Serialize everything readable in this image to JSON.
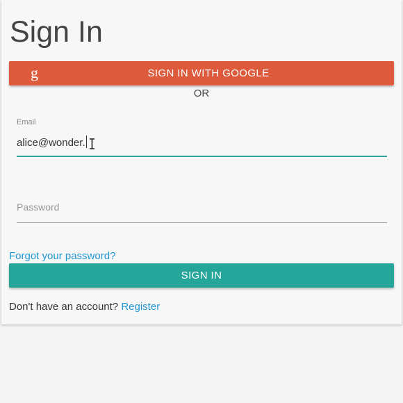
{
  "page": {
    "title": "Sign In"
  },
  "google_button": {
    "label": "SIGN IN WITH GOOGLE",
    "icon": "g",
    "color": "#dd5a3c"
  },
  "divider": {
    "text": "OR"
  },
  "email": {
    "label": "Email",
    "value": "alice@wonder."
  },
  "password": {
    "placeholder": "Password"
  },
  "forgot_link": {
    "text": "Forgot your password?"
  },
  "signin_button": {
    "label": "SIGN IN",
    "color": "#26a69a"
  },
  "register": {
    "prompt": "Don't have an account?",
    "link_text": "Register"
  },
  "colors": {
    "link": "#2196d3",
    "accent": "#26a69a"
  }
}
